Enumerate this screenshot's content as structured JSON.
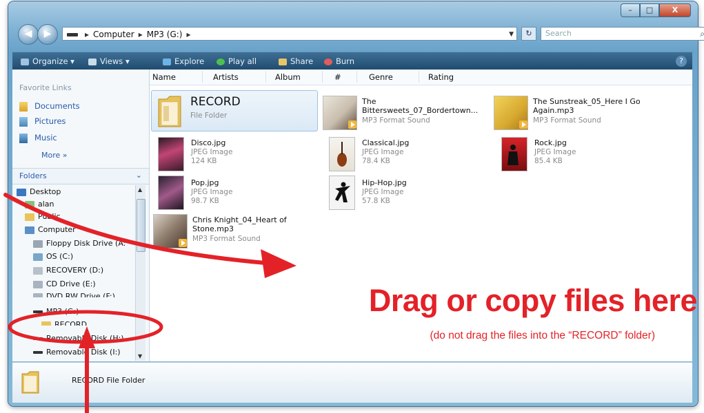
{
  "window": {
    "caption_buttons": [
      "–",
      "□",
      "X"
    ]
  },
  "address": {
    "breadcrumb": [
      "Computer",
      "MP3 (G:)"
    ],
    "search_placeholder": "Search"
  },
  "toolbar": {
    "items": [
      "Organize",
      "Views",
      "Explore",
      "Play all",
      "Share",
      "Burn"
    ],
    "help": "?"
  },
  "nav": {
    "favorite_links_heading": "Favorite Links",
    "favorites": [
      "Documents",
      "Pictures",
      "Music"
    ],
    "more": "More »",
    "folders_heading": "Folders",
    "tree": [
      "Desktop",
      "alan",
      "Public",
      "Computer",
      "Floppy Disk Drive (A:",
      "OS (C:)",
      "RECOVERY (D:)",
      "CD Drive (E:)",
      "DVD RW Drive (F:)",
      "MP3 (G:)",
      "RECORD",
      "Removable Disk (H:)",
      "Removable Disk (I:)"
    ]
  },
  "columns": [
    "Name",
    "Artists",
    "Album",
    "#",
    "Genre",
    "Rating"
  ],
  "files": [
    {
      "name": "RECORD",
      "type": "File Folder",
      "size": ""
    },
    {
      "name": "The Bittersweets_07_Bordertown...",
      "type": "MP3 Format Sound",
      "size": ""
    },
    {
      "name": "The Sunstreak_05_Here I Go Again.mp3",
      "type": "MP3 Format Sound",
      "size": ""
    },
    {
      "name": "Disco.jpg",
      "type": "JPEG Image",
      "size": "124 KB"
    },
    {
      "name": "Classical.jpg",
      "type": "JPEG Image",
      "size": "78.4 KB"
    },
    {
      "name": "Rock.jpg",
      "type": "JPEG Image",
      "size": "85.4 KB"
    },
    {
      "name": "Pop.jpg",
      "type": "JPEG Image",
      "size": "98.7 KB"
    },
    {
      "name": "Hip-Hop.jpg",
      "type": "JPEG Image",
      "size": "57.8 KB"
    },
    {
      "name": "Chris Knight_04_Heart of Stone.mp3",
      "type": "MP3 Format Sound",
      "size": ""
    }
  ],
  "status": {
    "text": "RECORD File Folder"
  },
  "annotation": {
    "headline": "Drag or copy files here",
    "subtext": "(do not drag the files into the “RECORD” folder)",
    "color": "#e32228"
  }
}
